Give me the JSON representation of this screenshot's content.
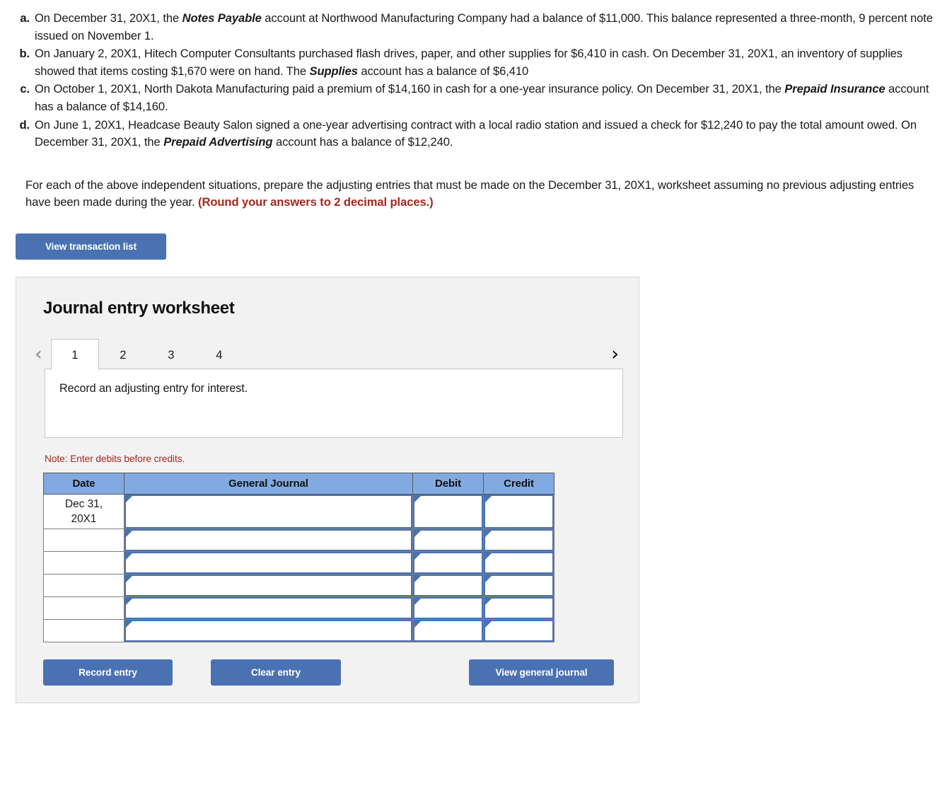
{
  "problem": {
    "situations": [
      {
        "marker": "a.",
        "parts": [
          {
            "t": "On December 31, 20X1, the ",
            "b": false
          },
          {
            "t": "Notes Payable",
            "b": true
          },
          {
            "t": " account at Northwood Manufacturing Company had a balance of $11,000. This balance represented a three-month, 9 percent note issued on November 1.",
            "b": false
          }
        ]
      },
      {
        "marker": "b.",
        "parts": [
          {
            "t": "On January 2, 20X1, Hitech Computer Consultants purchased flash drives, paper, and other supplies for $6,410 in cash. On December 31, 20X1, an inventory of supplies showed that items costing $1,670 were on hand. The ",
            "b": false
          },
          {
            "t": "Supplies",
            "b": true
          },
          {
            "t": " account has a balance of $6,410",
            "b": false
          }
        ]
      },
      {
        "marker": "c.",
        "parts": [
          {
            "t": "On October 1, 20X1, North Dakota Manufacturing paid a premium of $14,160 in cash for a one-year insurance policy. On December 31, 20X1, the ",
            "b": false
          },
          {
            "t": "Prepaid Insurance",
            "b": true
          },
          {
            "t": " account has a balance of $14,160.",
            "b": false
          }
        ]
      },
      {
        "marker": "d.",
        "parts": [
          {
            "t": "On June 1, 20X1, Headcase Beauty Salon signed a one-year advertising contract with a local radio station and issued a check for $12,240 to pay the total amount owed. On December 31, 20X1, the ",
            "b": false
          },
          {
            "t": "Prepaid Advertising",
            "b": true
          },
          {
            "t": " account has a balance of $12,240.",
            "b": false
          }
        ]
      }
    ],
    "instructions_text": "For each of the above independent situations, prepare the adjusting entries that must be made on the December 31, 20X1, worksheet assuming no previous adjusting entries have been made during the year. ",
    "instructions_emphasis": "(Round your answers to 2 decimal places.)"
  },
  "toolbar": {
    "view_transaction_list_label": "View transaction list"
  },
  "worksheet": {
    "title": "Journal entry worksheet",
    "prev_icon": "chevron-left-icon",
    "next_icon": "chevron-right-icon",
    "prev_glyph": "‹",
    "next_glyph": "›",
    "tabs": [
      {
        "label": "1",
        "active": true
      },
      {
        "label": "2",
        "active": false
      },
      {
        "label": "3",
        "active": false
      },
      {
        "label": "4",
        "active": false
      }
    ],
    "description": "Record an adjusting entry for interest.",
    "note": "Note: Enter debits before credits.",
    "table": {
      "headers": [
        "Date",
        "General Journal",
        "Debit",
        "Credit"
      ],
      "rows": [
        {
          "date": "Dec 31,\n20X1",
          "general_journal": "",
          "debit": "",
          "credit": ""
        },
        {
          "date": "",
          "general_journal": "",
          "debit": "",
          "credit": ""
        },
        {
          "date": "",
          "general_journal": "",
          "debit": "",
          "credit": ""
        },
        {
          "date": "",
          "general_journal": "",
          "debit": "",
          "credit": ""
        },
        {
          "date": "",
          "general_journal": "",
          "debit": "",
          "credit": ""
        },
        {
          "date": "",
          "general_journal": "",
          "debit": "",
          "credit": ""
        }
      ]
    },
    "actions": {
      "record_entry_label": "Record entry",
      "clear_entry_label": "Clear entry",
      "view_general_journal_label": "View general journal"
    }
  },
  "colors": {
    "button_blue": "#4a72b2",
    "table_header_blue": "#82aae2",
    "alert_red": "#a5281e",
    "panel_gray": "#f2f2f2"
  }
}
